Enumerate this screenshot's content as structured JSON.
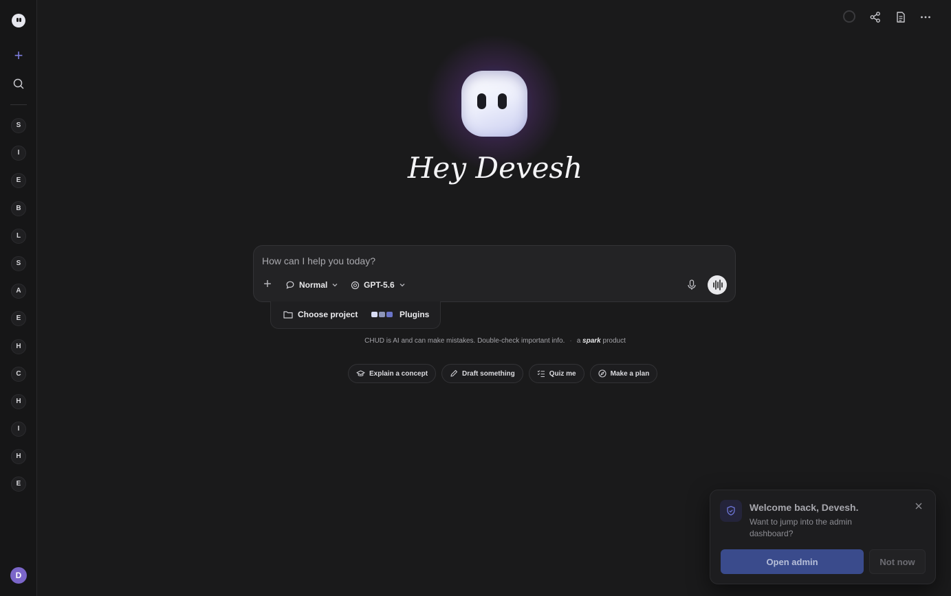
{
  "sidebar": {
    "logo_icon": "mascot-logo-icon",
    "new_chat_icon": "plus-icon",
    "search_icon": "search-icon",
    "items": [
      {
        "label": "S"
      },
      {
        "label": "I"
      },
      {
        "label": "E"
      },
      {
        "label": "B"
      },
      {
        "label": "L"
      },
      {
        "label": "S"
      },
      {
        "label": "A"
      },
      {
        "label": "E"
      },
      {
        "label": "H"
      },
      {
        "label": "C"
      },
      {
        "label": "H"
      },
      {
        "label": "I"
      },
      {
        "label": "H"
      },
      {
        "label": "E"
      }
    ],
    "avatar_initial": "D"
  },
  "topbar": {
    "icons": [
      "status-ring-icon",
      "share-icon",
      "document-icon",
      "more-icon"
    ]
  },
  "hero": {
    "greeting": "Hey Devesh"
  },
  "composer": {
    "placeholder": "How can I help you today?",
    "mode_label": "Normal",
    "model_label": "GPT-5.6",
    "project_label": "Choose project",
    "plugins_label": "Plugins"
  },
  "disclaimer": {
    "text": "CHUD is AI and can make mistakes. Double-check important info.",
    "prefix": "a",
    "brand": "spark",
    "suffix": "product"
  },
  "chips": [
    {
      "label": "Explain a concept",
      "icon": "graduation-cap-icon"
    },
    {
      "label": "Draft something",
      "icon": "pencil-icon"
    },
    {
      "label": "Quiz me",
      "icon": "checklist-icon"
    },
    {
      "label": "Make a plan",
      "icon": "compass-icon"
    }
  ],
  "toast": {
    "title": "Welcome back, Devesh.",
    "body": "Want to jump into the admin dashboard?",
    "primary_label": "Open admin",
    "secondary_label": "Not now"
  },
  "colors": {
    "background": "#1a1a1b",
    "accent": "#7d7dde",
    "primary_button": "#3a4b8c",
    "avatar": "#7b66c9"
  }
}
